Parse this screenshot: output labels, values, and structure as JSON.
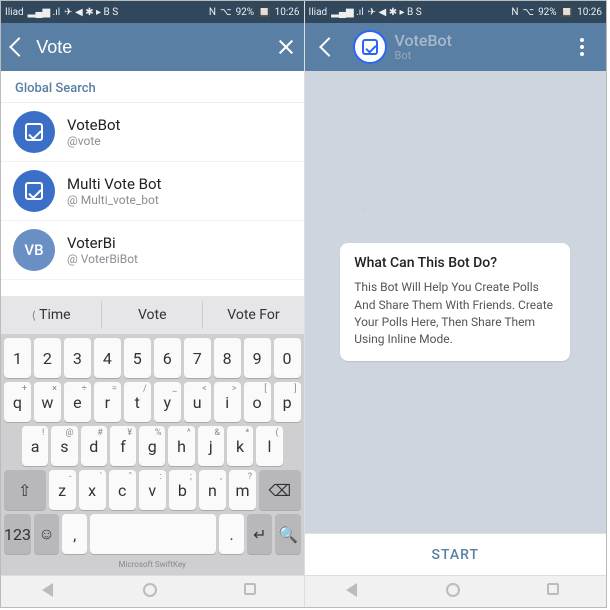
{
  "status": {
    "carrier": "Iliad",
    "signal_icons": "▂▄▆ .ıl",
    "extra_icons": "✈ ◀ ✱ ▸ B S",
    "nfc": "N",
    "bt": "⌥",
    "battery": "92%",
    "time": "10:26"
  },
  "left": {
    "search_value": "Vote",
    "section": "Global Search",
    "results": [
      {
        "name": "VoteBot",
        "handle": "@vote",
        "avatar_type": "checkbox",
        "avatar_text": ""
      },
      {
        "name": "Multi Vote Bot",
        "handle": "@ Multi_vote_bot",
        "avatar_type": "checkbox",
        "avatar_text": ""
      },
      {
        "name": "VoterBi",
        "handle": "@ VoterBiBot",
        "avatar_type": "initials",
        "avatar_text": "VB"
      }
    ],
    "suggestions": [
      "Time",
      "Vote",
      "Vote For"
    ],
    "keyboard": {
      "row_num": [
        "1",
        "2",
        "3",
        "4",
        "5",
        "6",
        "7",
        "8",
        "9",
        "0"
      ],
      "row1": [
        {
          "m": "q",
          "t": "+"
        },
        {
          "m": "w",
          "t": "×"
        },
        {
          "m": "e",
          "t": "÷"
        },
        {
          "m": "r",
          "t": "="
        },
        {
          "m": "t",
          "t": "/"
        },
        {
          "m": "y",
          "t": "_"
        },
        {
          "m": "u",
          "t": "<"
        },
        {
          "m": "i",
          "t": ">"
        },
        {
          "m": "o",
          "t": "["
        },
        {
          "m": "p",
          "t": "]"
        }
      ],
      "row2": [
        {
          "m": "a",
          "t": "!"
        },
        {
          "m": "s",
          "t": "@"
        },
        {
          "m": "d",
          "t": "#"
        },
        {
          "m": "f",
          "t": "¥"
        },
        {
          "m": "g",
          "t": "%"
        },
        {
          "m": "h",
          "t": "^"
        },
        {
          "m": "j",
          "t": "&"
        },
        {
          "m": "k",
          "t": "*"
        },
        {
          "m": "l",
          "t": "("
        }
      ],
      "row3": [
        {
          "m": "z",
          "t": "-"
        },
        {
          "m": "x",
          "t": "'"
        },
        {
          "m": "c",
          "t": "\""
        },
        {
          "m": "v",
          "t": ":"
        },
        {
          "m": "b",
          "t": ";"
        },
        {
          "m": "n",
          "t": ","
        },
        {
          "m": "m",
          "t": "?"
        }
      ],
      "sym_key": "123",
      "brand": "Microsoft SwiftKey",
      "search_glyph": "🔍",
      "shift_glyph": "⇧",
      "bksp_glyph": "⌫",
      "emoji_glyph": "☺",
      "enter_glyph": "↵",
      "space_label": " ",
      "punct1": ",",
      "punct2": "."
    }
  },
  "right": {
    "title": "VoteBot",
    "subtitle": "Bot",
    "bubble_title": "What Can This Bot Do?",
    "bubble_body": "This Bot Will Help You Create Polls And Share Them With Friends. Create Your Polls Here, Then Share Them Using Inline Mode.",
    "start": "START"
  }
}
